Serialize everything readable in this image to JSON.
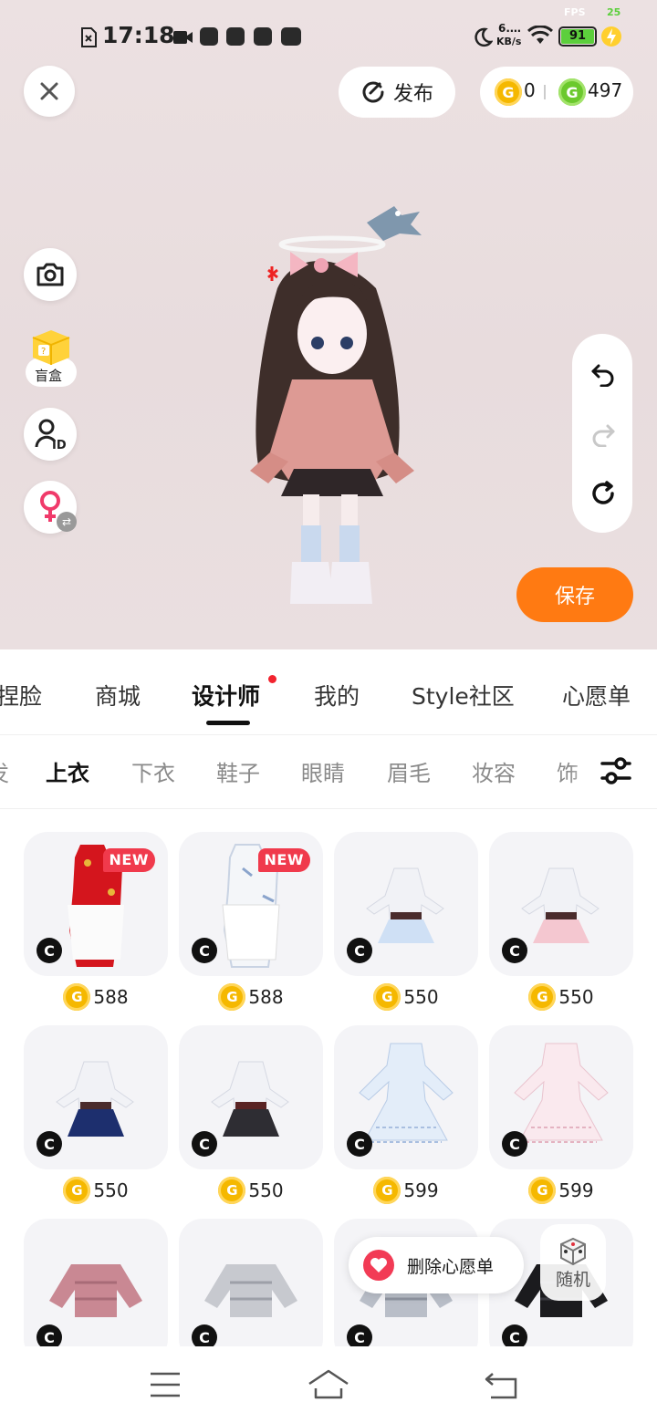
{
  "status_bar": {
    "time": "17:18",
    "speed_value": "6.…",
    "speed_unit": "KB/s",
    "battery": "91",
    "fps_label": "FPS",
    "fps_value": "25"
  },
  "top_bar": {
    "publish_label": "发布",
    "coins_gold": "0",
    "coins_green": "497"
  },
  "left_tools": {
    "mystery_box_label": "盲盒"
  },
  "save_label": "保存",
  "main_tabs": [
    "捏脸",
    "商城",
    "设计师",
    "我的",
    "Style社区",
    "心愿单"
  ],
  "active_main_tab": "设计师",
  "sub_tabs": [
    "发",
    "上衣",
    "下衣",
    "鞋子",
    "眼睛",
    "眉毛",
    "妆容",
    "饰"
  ],
  "active_sub_tab": "上衣",
  "items": [
    {
      "price": "588",
      "new": "NEW",
      "c": "C",
      "kind": "qipao-red"
    },
    {
      "price": "588",
      "new": "NEW",
      "c": "C",
      "kind": "qipao-white"
    },
    {
      "price": "550",
      "c": "C",
      "kind": "dress-blue"
    },
    {
      "price": "550",
      "c": "C",
      "kind": "dress-pink"
    },
    {
      "price": "550",
      "c": "C",
      "kind": "dress-navy"
    },
    {
      "price": "550",
      "c": "C",
      "kind": "dress-black"
    },
    {
      "price": "599",
      "c": "C",
      "kind": "gown-blue"
    },
    {
      "price": "599",
      "c": "C",
      "kind": "gown-pink"
    },
    {
      "price": "",
      "c": "C",
      "kind": "jacket-pink"
    },
    {
      "price": "",
      "c": "C",
      "kind": "jacket-grey"
    },
    {
      "price": "",
      "c": "C",
      "kind": "jacket-silver"
    },
    {
      "price": "",
      "c": "C",
      "kind": "jacket-black"
    }
  ],
  "wishlist_label": "删除心愿单",
  "random_label": "随机",
  "colors": {
    "accent": "#ff7a12",
    "gold_coin": "#f5b800",
    "green_coin": "#6bc92d",
    "new_badge": "#f03a4c",
    "red_dot": "#f2232e"
  }
}
